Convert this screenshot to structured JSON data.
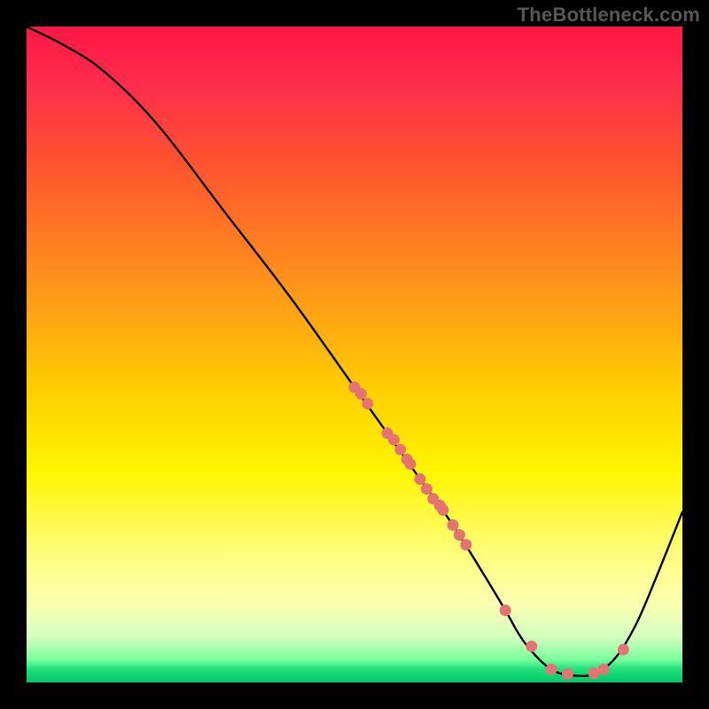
{
  "watermark": "TheBottleneck.com",
  "chart_data": {
    "type": "line",
    "title": "",
    "xlabel": "",
    "ylabel": "",
    "xlim": [
      0,
      100
    ],
    "ylim": [
      0,
      100
    ],
    "series": [
      {
        "name": "curve",
        "x": [
          0,
          6,
          12,
          20,
          30,
          40,
          50,
          55,
          60,
          65,
          70,
          73,
          76,
          80,
          84,
          87,
          90,
          93,
          96,
          100
        ],
        "y": [
          100,
          97,
          93,
          85,
          72,
          59,
          45,
          38,
          31,
          24,
          16,
          11,
          6,
          2,
          1,
          1.5,
          4,
          9,
          16,
          26
        ]
      }
    ],
    "scatter": {
      "name": "dots",
      "x": [
        50,
        51,
        52,
        55,
        56,
        57,
        58,
        58.5,
        60,
        61,
        62,
        63,
        63.5,
        65,
        66,
        67,
        73,
        77,
        80,
        82.5,
        86.5,
        88,
        91
      ],
      "y": [
        45,
        44,
        42.5,
        38,
        37,
        35.5,
        34,
        33.3,
        31,
        29.5,
        28,
        27,
        26.3,
        24,
        22.5,
        21,
        11,
        5.5,
        2,
        1.3,
        1.4,
        2,
        5
      ],
      "r": 6.5
    }
  },
  "colors": {
    "dot": "#e57373",
    "curve": "#000000",
    "bg_top": "#ff1744",
    "bg_bottom": "#00c86a"
  }
}
